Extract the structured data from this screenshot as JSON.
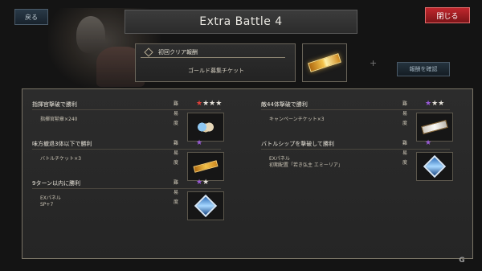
{
  "header": {
    "title": "Extra Battle 4",
    "close_label": "閉じる",
    "back_label": "戻る"
  },
  "first_clear": {
    "label": "初回クリア報酬",
    "reward_name": "ゴールド募集チケット",
    "confirm_label": "報酬を確認"
  },
  "conditions": [
    {
      "title": "指揮官撃破で勝利",
      "difficulty_label": "難易度",
      "stars": [
        {
          "c": "red"
        },
        {
          "c": "white"
        },
        {
          "c": "white"
        },
        {
          "c": "white"
        }
      ],
      "reward": "指揮官勲章×240",
      "icon": "medals-icon"
    },
    {
      "title": "敵44体撃破で勝利",
      "difficulty_label": "難易度",
      "stars": [
        {
          "c": "purple"
        },
        {
          "c": "white"
        },
        {
          "c": "white"
        }
      ],
      "reward": "キャンペーンチケット×3",
      "icon": "white-ticket-icon"
    },
    {
      "title": "味方撤退3体以下で勝利",
      "difficulty_label": "難易度",
      "stars": [
        {
          "c": "purple"
        }
      ],
      "reward": "バトルチケット×3",
      "icon": "gold-ticket-icon"
    },
    {
      "title": "バトルシップを撃破して勝利",
      "difficulty_label": "難易度",
      "stars": [
        {
          "c": "purple"
        }
      ],
      "reward": "EXパネル\n初期配置「若き弘主 エミーリア」",
      "icon": "ex-panel-icon"
    },
    {
      "title": "9ターン以内に勝利",
      "difficulty_label": "難易度",
      "stars": [
        {
          "c": "purple"
        },
        {
          "c": "white"
        }
      ],
      "reward": "EXパネル\nSP+7",
      "icon": "ex-panel-icon"
    }
  ],
  "colors": {
    "star_red": "#e0403a",
    "star_white": "#e6e2da",
    "star_purple": "#9a5ad8",
    "close_button": "#c0272d"
  },
  "watermark": "G"
}
